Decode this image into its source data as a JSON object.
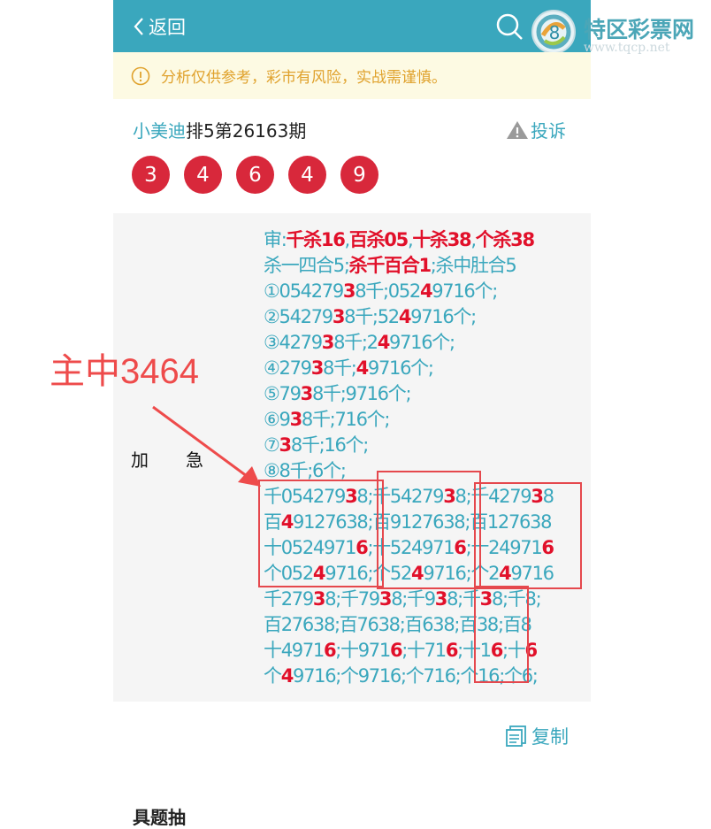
{
  "header": {
    "back_label": "返回",
    "logo_text": "特区彩票网",
    "logo_url": "www.tqcp.net"
  },
  "notice": {
    "text": "分析仅供参考，彩市有风险，实战需谨慎。"
  },
  "post": {
    "author": "小美迪",
    "title_rest": "排5第26163期",
    "complain_label": "投诉"
  },
  "balls": [
    "3",
    "4",
    "6",
    "4",
    "9"
  ],
  "side_label": [
    "加",
    "急"
  ],
  "annotation": "主中3464",
  "content_lines": [
    [
      [
        "审:",
        0
      ],
      [
        "千杀16",
        1
      ],
      [
        ",",
        0
      ],
      [
        "百杀05",
        1
      ],
      [
        ",",
        0
      ],
      [
        "十杀38",
        1
      ],
      [
        ",",
        0
      ],
      [
        "个杀38",
        1
      ]
    ],
    [
      [
        "杀一四合5;",
        0
      ],
      [
        "杀千百合1",
        1
      ],
      [
        ";杀中肚合5",
        0
      ]
    ],
    [
      [
        "①054279",
        0
      ],
      [
        "3",
        1
      ],
      [
        "8千;052",
        0
      ],
      [
        "4",
        1
      ],
      [
        "9716个;",
        0
      ]
    ],
    [
      [
        "②54279",
        0
      ],
      [
        "3",
        1
      ],
      [
        "8千;52",
        0
      ],
      [
        "4",
        1
      ],
      [
        "9716个;",
        0
      ]
    ],
    [
      [
        "③4279",
        0
      ],
      [
        "3",
        1
      ],
      [
        "8千;2",
        0
      ],
      [
        "4",
        1
      ],
      [
        "9716个;",
        0
      ]
    ],
    [
      [
        "④279",
        0
      ],
      [
        "3",
        1
      ],
      [
        "8千;",
        0
      ],
      [
        "4",
        1
      ],
      [
        "9716个;",
        0
      ]
    ],
    [
      [
        "⑤79",
        0
      ],
      [
        "3",
        1
      ],
      [
        "8千;9716个;",
        0
      ]
    ],
    [
      [
        "⑥9",
        0
      ],
      [
        "3",
        1
      ],
      [
        "8千;716个;",
        0
      ]
    ],
    [
      [
        "⑦",
        0
      ],
      [
        "3",
        1
      ],
      [
        "8千;16个;",
        0
      ]
    ],
    [
      [
        "⑧8千;6个;",
        0
      ]
    ],
    [
      [
        "千054279",
        0
      ],
      [
        "3",
        1
      ],
      [
        "8;千54279",
        0
      ],
      [
        "3",
        1
      ],
      [
        "8;千4279",
        0
      ],
      [
        "3",
        1
      ],
      [
        "8",
        0
      ]
    ],
    [
      [
        "百",
        0
      ],
      [
        "4",
        1
      ],
      [
        "9127638;百9127638;百127638",
        0
      ]
    ],
    [
      [
        "十0524971",
        0
      ],
      [
        "6",
        1
      ],
      [
        ";十524971",
        0
      ],
      [
        "6",
        1
      ],
      [
        ";十24971",
        0
      ],
      [
        "6",
        1
      ]
    ],
    [
      [
        "个052",
        0
      ],
      [
        "4",
        1
      ],
      [
        "9716;个52",
        0
      ],
      [
        "4",
        1
      ],
      [
        "9716;个2",
        0
      ],
      [
        "4",
        1
      ],
      [
        "9716",
        0
      ]
    ],
    [
      [
        "千279",
        0
      ],
      [
        "3",
        1
      ],
      [
        "8;千79",
        0
      ],
      [
        "3",
        1
      ],
      [
        "8;千9",
        0
      ],
      [
        "3",
        1
      ],
      [
        "8;千",
        0
      ],
      [
        "3",
        1
      ],
      [
        "8;千8;",
        0
      ]
    ],
    [
      [
        "百27638;百7638;百638;百38;百8",
        0
      ]
    ],
    [
      [
        "十4971",
        0
      ],
      [
        "6",
        1
      ],
      [
        ";十971",
        0
      ],
      [
        "6",
        1
      ],
      [
        ";十71",
        0
      ],
      [
        "6",
        1
      ],
      [
        ";十1",
        0
      ],
      [
        "6",
        1
      ],
      [
        ";十",
        0
      ],
      [
        "6",
        1
      ]
    ],
    [
      [
        "个",
        0
      ],
      [
        "4",
        1
      ],
      [
        "9716;个9716;个716;个16;个6;",
        0
      ]
    ]
  ],
  "copy_label": "复制",
  "bottom_text": "具题抽",
  "colors": {
    "header_bg": "#3aa7bd",
    "accent": "#3aa7bd",
    "ball": "#d8283b",
    "highlight": "#e1102a",
    "notice_bg": "#fdfae3",
    "notice_text": "#e0a22d",
    "annotation": "#ee4b4b"
  }
}
